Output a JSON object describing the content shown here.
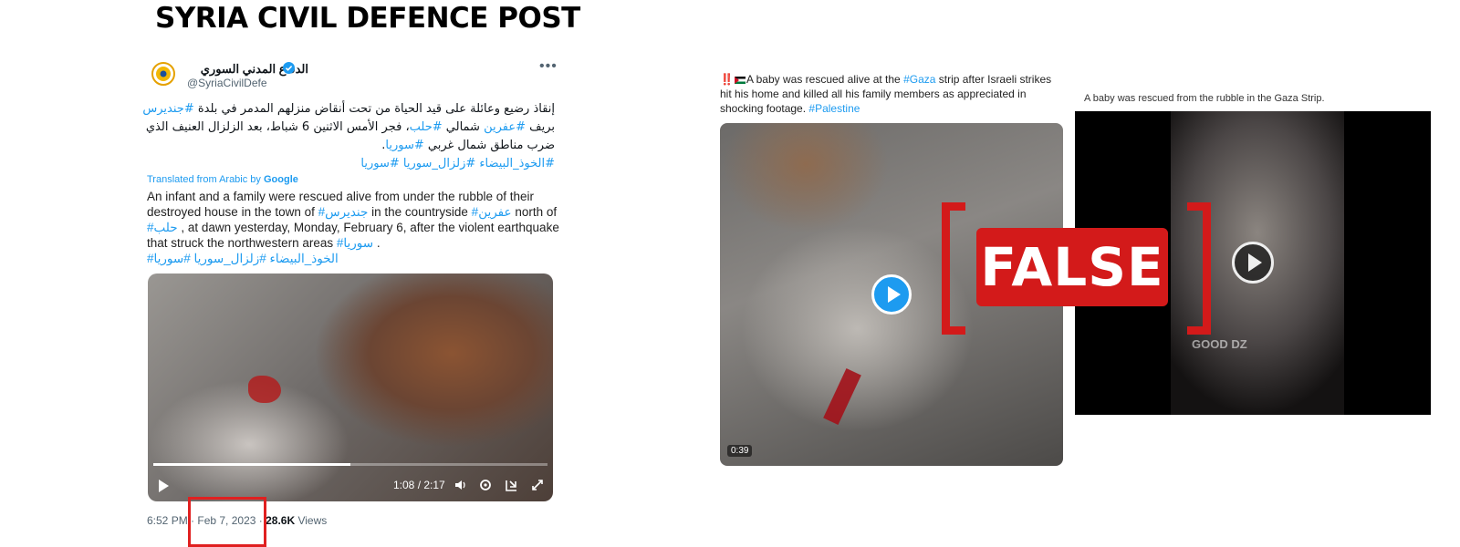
{
  "headline": "SYRIA CIVIL DEFENCE POST",
  "left_tweet": {
    "display_name": "الدفاع المدني السوري",
    "handle": "@SyriaCivilDefe",
    "arabic_text_1": "إنقاذ رضيع وعائلة على قيد الحياة من تحت أنقاض منزلهم المدمر في بلدة ",
    "arabic_tag_1": "#جنديرس",
    "arabic_text_2": " بريف ",
    "arabic_tag_2": "#عفرين",
    "arabic_text_3": " شمالي ",
    "arabic_tag_3": "#حلب",
    "arabic_text_4": "، فجر الأمس الاثنين 6 شباط، بعد الزلزال العنيف الذي ضرب مناطق شمال غربي ",
    "arabic_tag_4": "#سوريا",
    "arabic_text_5": ".",
    "arabic_tags_line": "#الخوذ_البيضاء #زلزال_سوريا #سوريا",
    "translated_label": "Translated from Arabic by",
    "translated_brand": "Google",
    "en_1": "An infant and a family were rescued alive from under the rubble of their destroyed house in the town of ",
    "en_tag_1": "#جنديرس",
    "en_2": " in the countryside ",
    "en_tag_2": "#عفرين",
    "en_3": " north of ",
    "en_tag_3": "#حلب",
    "en_4": " , at dawn yesterday, Monday, February 6, after the violent earthquake that struck the northwestern areas ",
    "en_tag_4": "#سوريا",
    "en_5": " .",
    "en_tags_line": "#الخوذ_البيضاء #زلزال_سوريا #سوريا",
    "video": {
      "time": "1:08 / 2:17",
      "progress_fraction": 0.5
    },
    "meta_time": "6:52 PM",
    "meta_sep": " · ",
    "meta_date": "Feb 7, 2023",
    "meta_sep2": " · ",
    "meta_views_count": "28.6K",
    "meta_views_label": " Views"
  },
  "mid_tweet": {
    "prefix": "‼️",
    "text_1": "A baby was rescued alive at the ",
    "tag_1": "#Gaza",
    "text_2": " strip after Israeli strikes hit his home and killed all his family members as appreciated in shocking footage. ",
    "tag_2": "#Palestine",
    "duration": "0:39"
  },
  "right_tweet": {
    "caption": "A baby was rescued from the rubble in the Gaza Strip.",
    "watermark": "GOOD DZ"
  },
  "stamp": {
    "label": "FALSE",
    "color": "#d31a1a"
  },
  "icons": [
    "verified-badge-icon",
    "more-icon",
    "play-icon",
    "volume-icon",
    "settings-icon",
    "pip-icon",
    "fullscreen-icon"
  ]
}
